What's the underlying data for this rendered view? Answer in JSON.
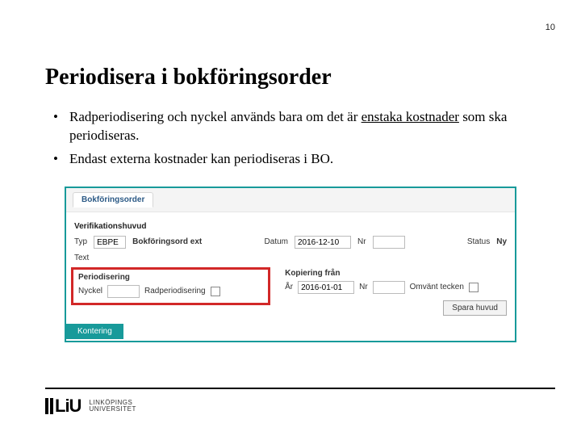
{
  "page_number": "10",
  "title": "Periodisera i bokföringsorder",
  "bullets": [
    {
      "pre": "Radperiodisering och nyckel används bara om det är ",
      "u": "enstaka kostnader",
      "post": " som ska periodiseras."
    },
    {
      "pre": "Endast externa kostnader kan periodiseras i BO.",
      "u": "",
      "post": ""
    }
  ],
  "form": {
    "tab": "Bokföringsorder",
    "section1": "Verifikationshuvud",
    "typ_label": "Typ",
    "typ_value": "EBPE",
    "typ_desc": "Bokföringsord ext",
    "datum_label": "Datum",
    "datum_value": "2016-12-10",
    "nr_label": "Nr",
    "status_label": "Status",
    "status_value": "Ny",
    "text_label": "Text",
    "periodisering_head": "Periodisering",
    "nyckel_label": "Nyckel",
    "radper_label": "Radperiodisering",
    "kopiering_head": "Kopiering från",
    "ar_label": "År",
    "ar_value": "2016-01-01",
    "nr2_label": "Nr",
    "omvant_label": "Omvänt tecken",
    "save_btn": "Spara huvud",
    "bottom_tab": "Kontering"
  },
  "footer": {
    "logo_text_1": "LINKÖPINGS",
    "logo_text_2": "UNIVERSITET"
  }
}
